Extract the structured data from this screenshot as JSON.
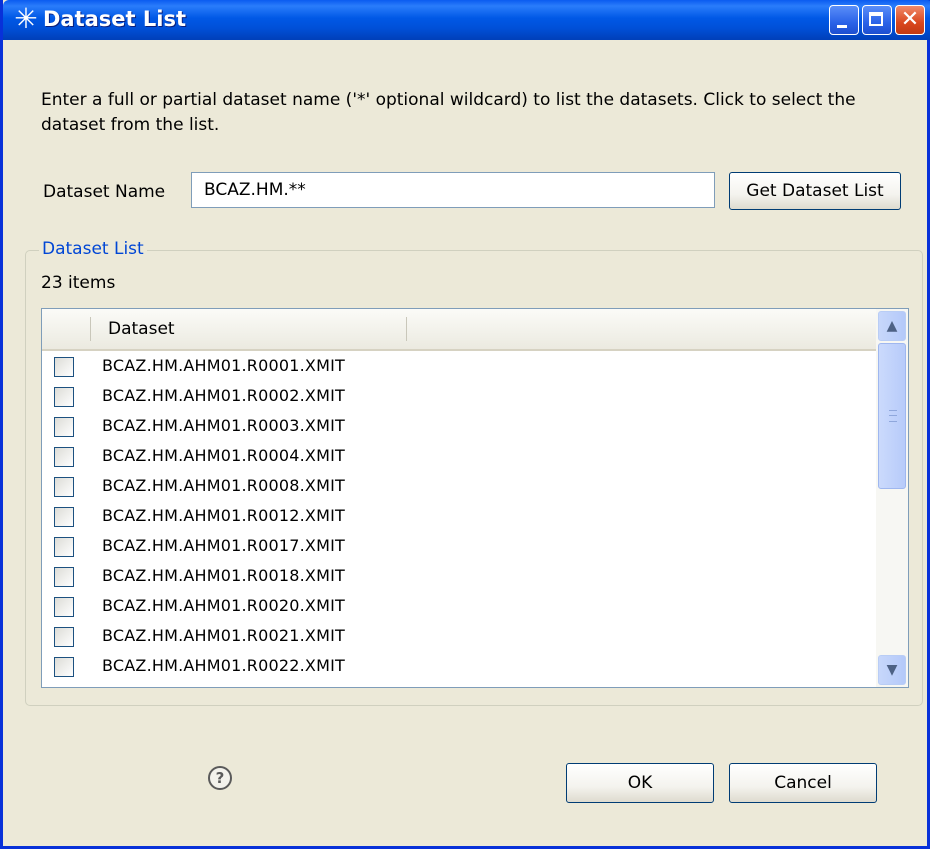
{
  "window": {
    "title": "Dataset List",
    "icon": "asterisk-icon",
    "controls": [
      "minimize-icon",
      "maximize-icon",
      "close-icon"
    ]
  },
  "instructions": "Enter a full or partial dataset name ('*' optional wildcard) to list the datasets.   Click to select the dataset from the list.",
  "dataset_name": {
    "label": "Dataset Name",
    "value": "BCAZ.HM.**"
  },
  "get_button": "Get Dataset List",
  "group": {
    "title": "Dataset List",
    "item_count": "23 items",
    "column_header": "Dataset",
    "rows": [
      "BCAZ.HM.AHM01.R0001.XMIT",
      "BCAZ.HM.AHM01.R0002.XMIT",
      "BCAZ.HM.AHM01.R0003.XMIT",
      "BCAZ.HM.AHM01.R0004.XMIT",
      "BCAZ.HM.AHM01.R0008.XMIT",
      "BCAZ.HM.AHM01.R0012.XMIT",
      "BCAZ.HM.AHM01.R0017.XMIT",
      "BCAZ.HM.AHM01.R0018.XMIT",
      "BCAZ.HM.AHM01.R0020.XMIT",
      "BCAZ.HM.AHM01.R0021.XMIT",
      "BCAZ.HM.AHM01.R0022.XMIT"
    ]
  },
  "footer": {
    "help_icon": "help-icon",
    "help_glyph": "?",
    "ok": "OK",
    "cancel": "Cancel"
  },
  "colors": {
    "titlebar": "#0058e6",
    "group_title": "#0046d5",
    "dialog_bg": "#ece9d8"
  }
}
